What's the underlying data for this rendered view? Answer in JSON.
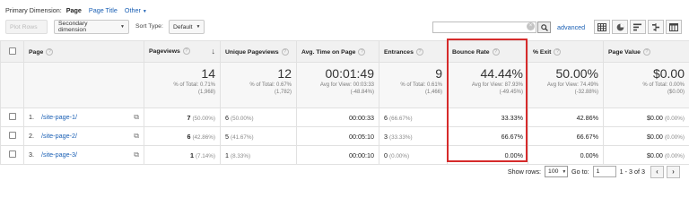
{
  "dimension_bar": {
    "label": "Primary Dimension:",
    "active": "Page",
    "page_title": "Page Title",
    "other": "Other"
  },
  "toolbar": {
    "plot_rows": "Plot Rows",
    "secondary_dimension": "Secondary dimension",
    "sort_type_label": "Sort Type:",
    "sort_type_value": "Default",
    "search_value": "",
    "advanced": "advanced"
  },
  "table": {
    "columns": {
      "page": "Page",
      "pageviews": "Pageviews",
      "unique_pageviews": "Unique Pageviews",
      "avg_time": "Avg. Time on Page",
      "entrances": "Entrances",
      "bounce_rate": "Bounce Rate",
      "exit": "% Exit",
      "page_value": "Page Value"
    },
    "totals": {
      "pageviews": {
        "value": "14",
        "line1": "% of Total: 0.71%",
        "line2": "(1,968)"
      },
      "unique_pageviews": {
        "value": "12",
        "line1": "% of Total: 0.67%",
        "line2": "(1,782)"
      },
      "avg_time": {
        "value": "00:01:49",
        "line1": "Avg for View: 00:03:33",
        "line2": "(-48.84%)"
      },
      "entrances": {
        "value": "9",
        "line1": "% of Total: 0.61%",
        "line2": "(1,466)"
      },
      "bounce_rate": {
        "value": "44.44%",
        "line1": "Avg for View: 87.93%",
        "line2": "(-49.45%)"
      },
      "exit": {
        "value": "50.00%",
        "line1": "Avg for View: 74.49%",
        "line2": "(-32.88%)"
      },
      "page_value": {
        "value": "$0.00",
        "line1": "% of Total: 0.00%",
        "line2": "($0.00)"
      }
    },
    "rows": [
      {
        "index": "1.",
        "page": "/site-page-1/",
        "pageviews": "7",
        "pageviews_pct": "(50.00%)",
        "unique": "6",
        "unique_pct": "(50.00%)",
        "avg_time": "00:00:33",
        "entrances": "6",
        "entrances_pct": "(66.67%)",
        "bounce": "33.33%",
        "exit": "42.86%",
        "value": "$0.00",
        "value_pct": "(0.00%)"
      },
      {
        "index": "2.",
        "page": "/site-page-2/",
        "pageviews": "6",
        "pageviews_pct": "(42.86%)",
        "unique": "5",
        "unique_pct": "(41.67%)",
        "avg_time": "00:05:10",
        "entrances": "3",
        "entrances_pct": "(33.33%)",
        "bounce": "66.67%",
        "exit": "66.67%",
        "value": "$0.00",
        "value_pct": "(0.00%)"
      },
      {
        "index": "3.",
        "page": "/site-page-3/",
        "pageviews": "1",
        "pageviews_pct": "(7.14%)",
        "unique": "1",
        "unique_pct": "(8.33%)",
        "avg_time": "00:00:10",
        "entrances": "0",
        "entrances_pct": "(0.00%)",
        "bounce": "0.00%",
        "exit": "0.00%",
        "value": "$0.00",
        "value_pct": "(0.00%)"
      }
    ]
  },
  "pager": {
    "show_rows_label": "Show rows:",
    "show_rows_value": "100",
    "goto_label": "Go to:",
    "goto_value": "1",
    "range": "1 - 3 of 3"
  },
  "colors": {
    "link": "#1a5fb4",
    "highlight": "#d62b2b"
  }
}
